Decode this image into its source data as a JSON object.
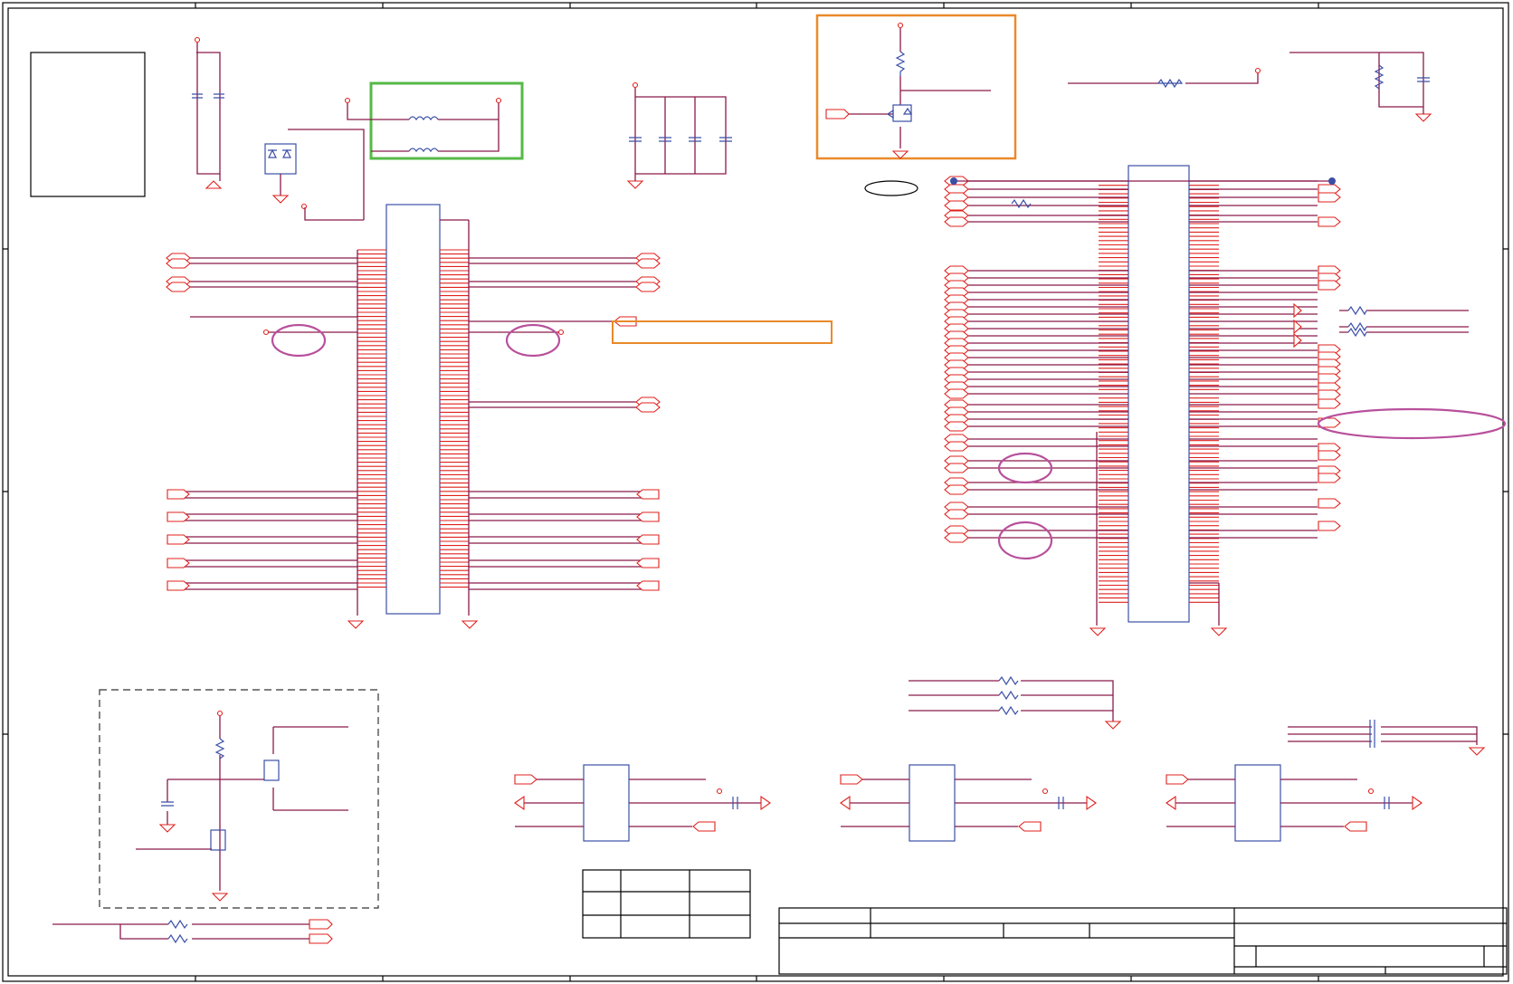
{
  "title": "",
  "layout": {
    "wire_color": "#8b1a4a",
    "pin_color": "#e0201c",
    "body_color": "#3b4fa6",
    "highlight_green": "#56b948",
    "highlight_orange": "#e98a2a",
    "highlight_purple": "#b8509c"
  }
}
